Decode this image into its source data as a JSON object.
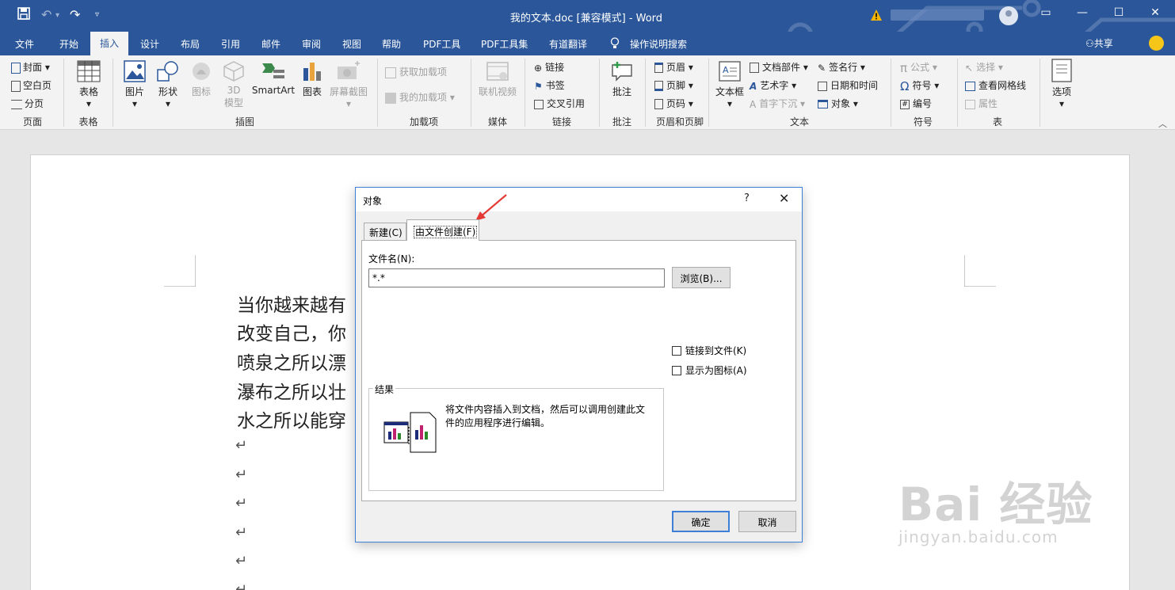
{
  "titlebar": {
    "title": "我的文本.doc [兼容模式] - Word"
  },
  "tabs": [
    "文件",
    "开始",
    "插入",
    "设计",
    "布局",
    "引用",
    "邮件",
    "审阅",
    "视图",
    "帮助",
    "PDF工具",
    "PDF工具集",
    "有道翻译"
  ],
  "active_tab": "插入",
  "tell_me": "操作说明搜索",
  "share": "共享",
  "ribbon": {
    "pages": {
      "label": "页面",
      "cover": "封面",
      "blank": "空白页",
      "break": "分页"
    },
    "tables": {
      "label": "表格",
      "table": "表格"
    },
    "illustrations": {
      "label": "插图",
      "pictures": "图片",
      "shapes": "形状",
      "icons": "图标",
      "model3d_a": "3D",
      "model3d_b": "模型",
      "smartart": "SmartArt",
      "chart": "图表",
      "screenshot": "屏幕截图"
    },
    "addins": {
      "label": "加载项",
      "get": "获取加载项",
      "mine": "我的加载项"
    },
    "media": {
      "label": "媒体",
      "video": "联机视频"
    },
    "links": {
      "label": "链接",
      "link": "链接",
      "bookmark": "书签",
      "crossref": "交叉引用"
    },
    "comments": {
      "label": "批注",
      "comment": "批注"
    },
    "headerfooter": {
      "label": "页眉和页脚",
      "header": "页眉",
      "footer": "页脚",
      "pagenum": "页码"
    },
    "text": {
      "label": "文本",
      "textbox": "文本框",
      "parts": "文档部件",
      "wordart": "艺术字",
      "dropcap": "首字下沉",
      "sigline": "签名行",
      "datetime": "日期和时间",
      "object": "对象"
    },
    "symbols": {
      "label": "符号",
      "equation": "公式",
      "symbol": "符号",
      "number": "编号"
    },
    "table2": {
      "label": "表",
      "select": "选择",
      "gridlines": "查看网格线",
      "properties": "属性"
    },
    "options": {
      "label": "选项"
    }
  },
  "document": {
    "lines": [
      "当你越来越有",
      "改变自己，你",
      "喷泉之所以漂",
      "瀑布之所以壮",
      "水之所以能穿"
    ],
    "para_mark": "↵"
  },
  "dialog": {
    "title": "对象",
    "help": "?",
    "close": "✕",
    "tab_new": "新建(C)",
    "tab_from_file": "由文件创建(F)",
    "filename_label": "文件名(N):",
    "filename_value": "*.*",
    "browse": "浏览(B)...",
    "link_to_file": "链接到文件(K)",
    "display_as_icon": "显示为图标(A)",
    "result_label": "结果",
    "result_text": "将文件内容插入到文档，然后可以调用创建此文件的应用程序进行编辑。",
    "ok": "确定",
    "cancel": "取消"
  },
  "watermark": {
    "brand": "Bai  经验",
    "url": "jingyan.baidu.com"
  },
  "colors": {
    "accent": "#2b579a",
    "dialog_border": "#3e7ed6",
    "arrow": "#e53935"
  }
}
